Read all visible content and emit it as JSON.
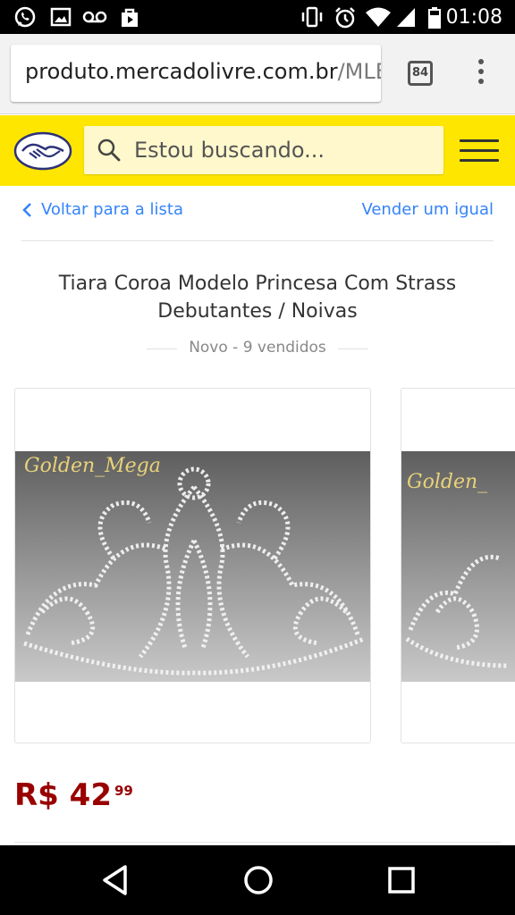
{
  "status_bar": {
    "time": "01:08",
    "left_icons": [
      "whatsapp-icon",
      "gallery-icon",
      "voicemail-icon",
      "play-store-icon"
    ],
    "right_icons": [
      "vibrate-icon",
      "alarm-icon",
      "wifi-icon",
      "signal-icon",
      "battery-icon"
    ]
  },
  "browser": {
    "url_host": "produto.mercadolivre.com.br",
    "url_path": "/MLB-",
    "tab_count": "84"
  },
  "header": {
    "search_placeholder": "Estou buscando...",
    "brand_color": "#ffe600"
  },
  "nav": {
    "back_label": "Voltar para a lista",
    "sell_label": "Vender um igual"
  },
  "product": {
    "title": "Tiara Coroa Modelo Princesa Com Strass Debutantes / Noivas",
    "condition": "Novo - 9 vendidos",
    "watermark": "Golden_Mega",
    "watermark_partial": "Golden_",
    "price_main": "R$ 42",
    "price_cents": "99",
    "price_color": "#990000"
  },
  "android_nav": {
    "buttons": [
      "back-icon",
      "home-icon",
      "recents-icon"
    ]
  }
}
